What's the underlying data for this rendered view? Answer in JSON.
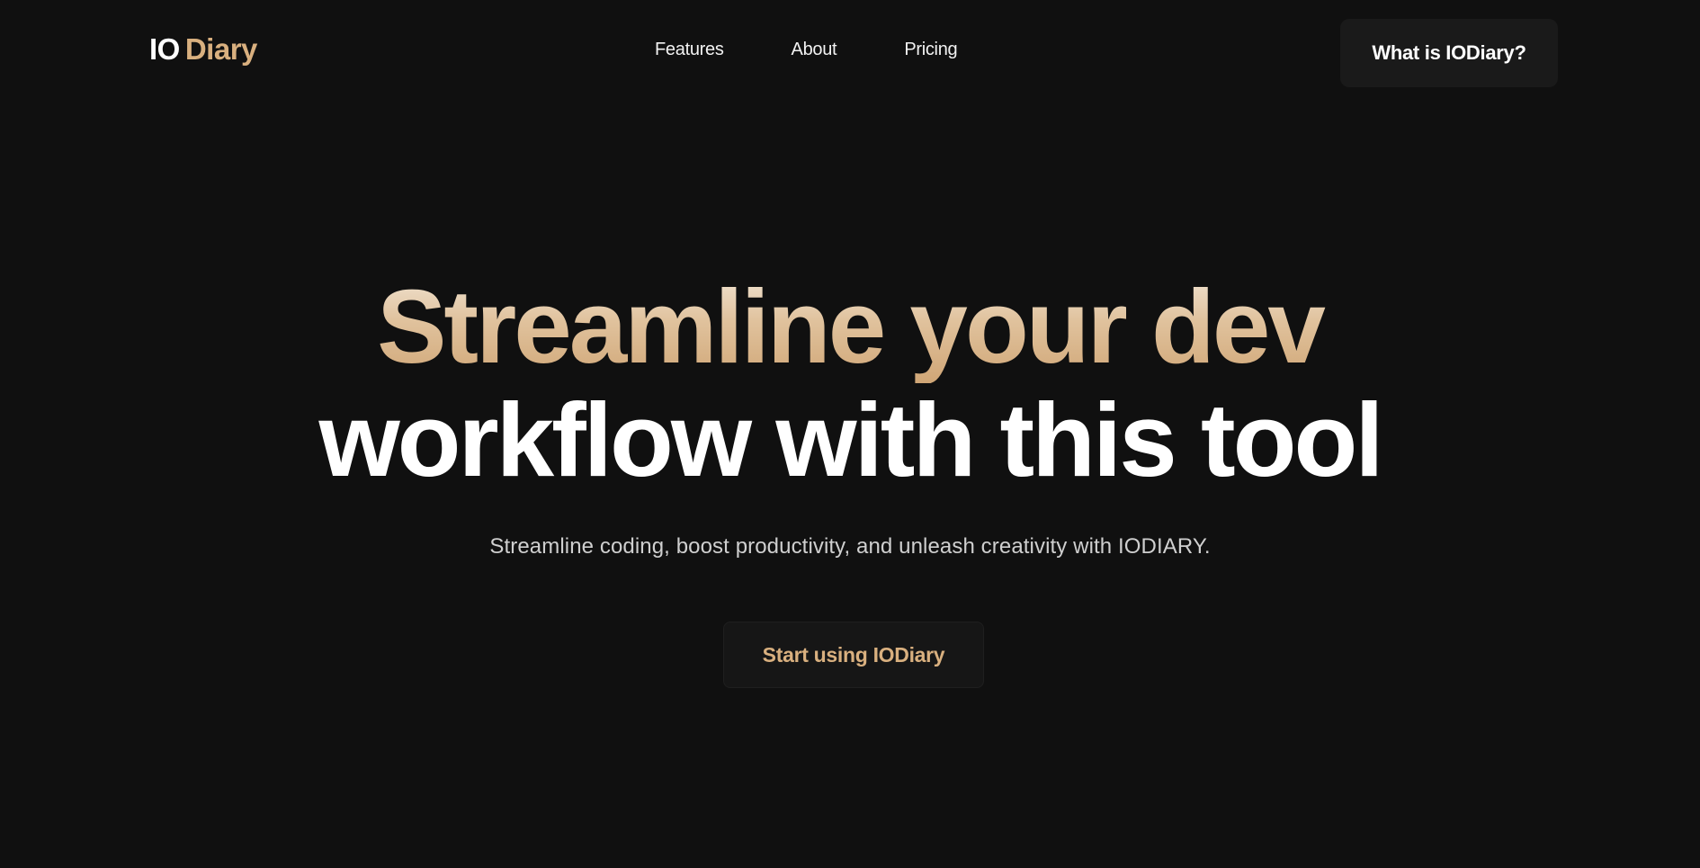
{
  "brand": {
    "logo_primary": "IO",
    "logo_secondary": "Diary",
    "accent_color": "#d9b07f"
  },
  "nav": {
    "items": [
      {
        "label": "Features"
      },
      {
        "label": "About"
      },
      {
        "label": "Pricing"
      }
    ]
  },
  "header": {
    "cta_label": "What is IODiary?"
  },
  "hero": {
    "headline_line1": "Streamline your dev",
    "headline_line2": "workflow with this tool",
    "subtitle": "Streamline coding, boost productivity, and unleash creativity with IODIARY.",
    "cta_label": "Start using IODiary"
  },
  "colors": {
    "background": "#101010",
    "button_background": "#1a1a1a",
    "text_primary": "#ffffff",
    "text_secondary": "#cfcfcf"
  }
}
